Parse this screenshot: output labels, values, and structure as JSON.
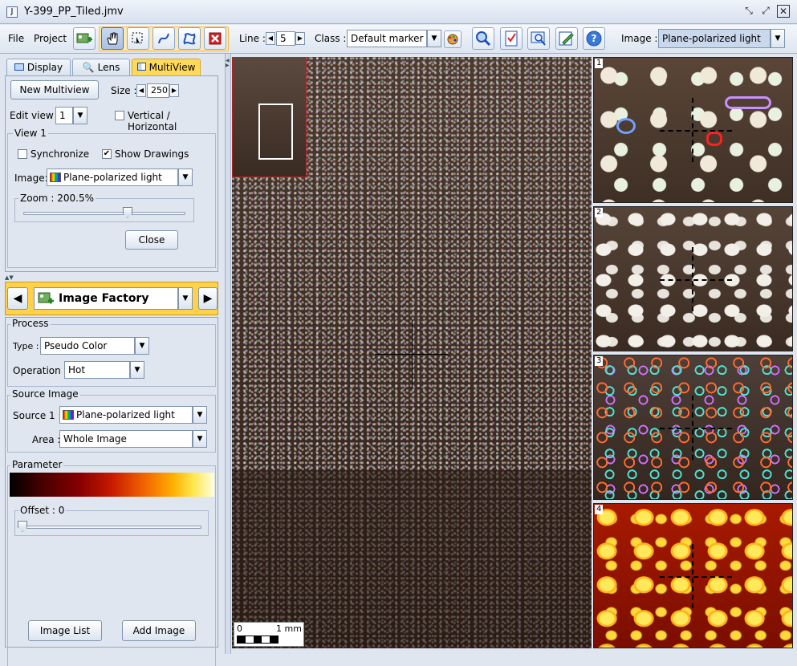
{
  "window": {
    "title": "Y-399_PP_Tiled.jmv",
    "app_icon": "J"
  },
  "menu": {
    "file": "File",
    "project": "Project"
  },
  "toolbar": {
    "line_label": "Line :",
    "line_value": "5",
    "class_label": "Class :",
    "class_value": "Default marker",
    "image_label": "Image :",
    "image_value": "Plane-polarized light"
  },
  "tabs": [
    "Display",
    "Lens",
    "MultiView"
  ],
  "multiview": {
    "new_button": "New Multiview",
    "size_label": "Size :",
    "size_value": "250",
    "edit_view_label": "Edit view :",
    "edit_view_value": "1",
    "vertical_label": "Vertical / Horizontal",
    "view_title": "View 1",
    "synchronize_label": "Synchronize",
    "show_drawings_label": "Show Drawings",
    "image_label": "Image:",
    "image_value": "Plane-polarized light",
    "zoom_label": "Zoom : 200.5%",
    "close_button": "Close"
  },
  "factory": {
    "title": "Image Factory",
    "process_title": "Process",
    "type_label": "Type :",
    "type_value": "Pseudo Color",
    "operation_label": "Operation :",
    "operation_value": "Hot",
    "source_title": "Source Image",
    "source_label": "Source 1 :",
    "source_value": "Plane-polarized light",
    "area_label": "Area :",
    "area_value": "Whole Image",
    "parameter_title": "Parameter",
    "offset_label": "Offset : 0",
    "image_list_button": "Image List",
    "add_image_button": "Add Image"
  },
  "scalebar": {
    "left": "0",
    "right": "1 mm"
  },
  "views": [
    "1",
    "2",
    "3",
    "4"
  ]
}
